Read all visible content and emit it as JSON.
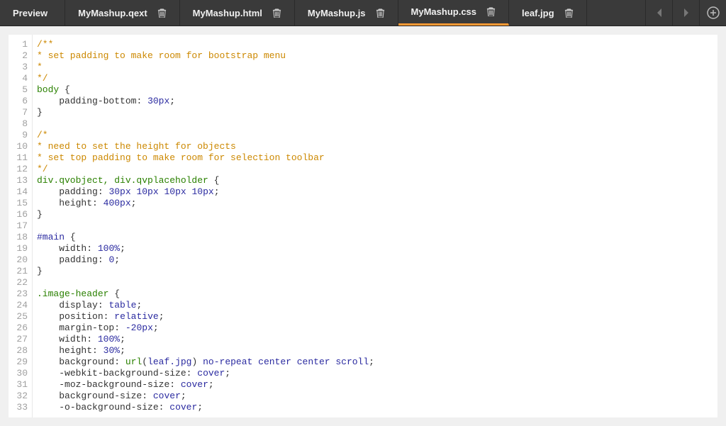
{
  "tabs": {
    "preview": "Preview",
    "items": [
      {
        "label": "MyMashup.qext",
        "closable": true,
        "active": false
      },
      {
        "label": "MyMashup.html",
        "closable": true,
        "active": false
      },
      {
        "label": "MyMashup.js",
        "closable": true,
        "active": false
      },
      {
        "label": "MyMashup.css",
        "closable": true,
        "active": true
      },
      {
        "label": "leaf.jpg",
        "closable": true,
        "active": false
      }
    ]
  },
  "editor": {
    "active_file": "MyMashup.css",
    "first_line": 1,
    "last_line": 33,
    "lines": [
      {
        "n": 1,
        "type": "comment",
        "text": "/**"
      },
      {
        "n": 2,
        "type": "comment",
        "text": "* set padding to make room for bootstrap menu"
      },
      {
        "n": 3,
        "type": "comment",
        "text": "*"
      },
      {
        "n": 4,
        "type": "comment",
        "text": "*/"
      },
      {
        "n": 5,
        "type": "selector-open",
        "selector": "body",
        "selector_kind": "tag"
      },
      {
        "n": 6,
        "type": "decl",
        "prop": "padding-bottom",
        "value": "30px"
      },
      {
        "n": 7,
        "type": "close"
      },
      {
        "n": 8,
        "type": "blank"
      },
      {
        "n": 9,
        "type": "comment",
        "text": "/*"
      },
      {
        "n": 10,
        "type": "comment",
        "text": "* need to set the height for objects"
      },
      {
        "n": 11,
        "type": "comment",
        "text": "* set top padding to make room for selection toolbar"
      },
      {
        "n": 12,
        "type": "comment",
        "text": "*/"
      },
      {
        "n": 13,
        "type": "selector-open",
        "selector": "div.qvobject, div.qvplaceholder",
        "selector_kind": "tagclass"
      },
      {
        "n": 14,
        "type": "decl",
        "prop": "padding",
        "value": "30px 10px 10px 10px"
      },
      {
        "n": 15,
        "type": "decl",
        "prop": "height",
        "value": "400px"
      },
      {
        "n": 16,
        "type": "close"
      },
      {
        "n": 17,
        "type": "blank"
      },
      {
        "n": 18,
        "type": "selector-open",
        "selector": "#main",
        "selector_kind": "id"
      },
      {
        "n": 19,
        "type": "decl",
        "prop": "width",
        "value": "100%"
      },
      {
        "n": 20,
        "type": "decl",
        "prop": "padding",
        "value": "0"
      },
      {
        "n": 21,
        "type": "close"
      },
      {
        "n": 22,
        "type": "blank"
      },
      {
        "n": 23,
        "type": "selector-open",
        "selector": ".image-header",
        "selector_kind": "class"
      },
      {
        "n": 24,
        "type": "decl",
        "prop": "display",
        "value": "table"
      },
      {
        "n": 25,
        "type": "decl",
        "prop": "position",
        "value": "relative"
      },
      {
        "n": 26,
        "type": "decl",
        "prop": "margin-top",
        "value": "-20px"
      },
      {
        "n": 27,
        "type": "decl",
        "prop": "width",
        "value": "100%"
      },
      {
        "n": 28,
        "type": "decl",
        "prop": "height",
        "value": "30%"
      },
      {
        "n": 29,
        "type": "bg-decl",
        "prop": "background",
        "url": "leaf.jpg",
        "rest": "no-repeat center center scroll"
      },
      {
        "n": 30,
        "type": "decl",
        "prop": "-webkit-background-size",
        "value": "cover"
      },
      {
        "n": 31,
        "type": "decl",
        "prop": "-moz-background-size",
        "value": "cover"
      },
      {
        "n": 32,
        "type": "decl",
        "prop": "background-size",
        "value": "cover"
      },
      {
        "n": 33,
        "type": "decl",
        "prop": "-o-background-size",
        "value": "cover"
      }
    ]
  }
}
